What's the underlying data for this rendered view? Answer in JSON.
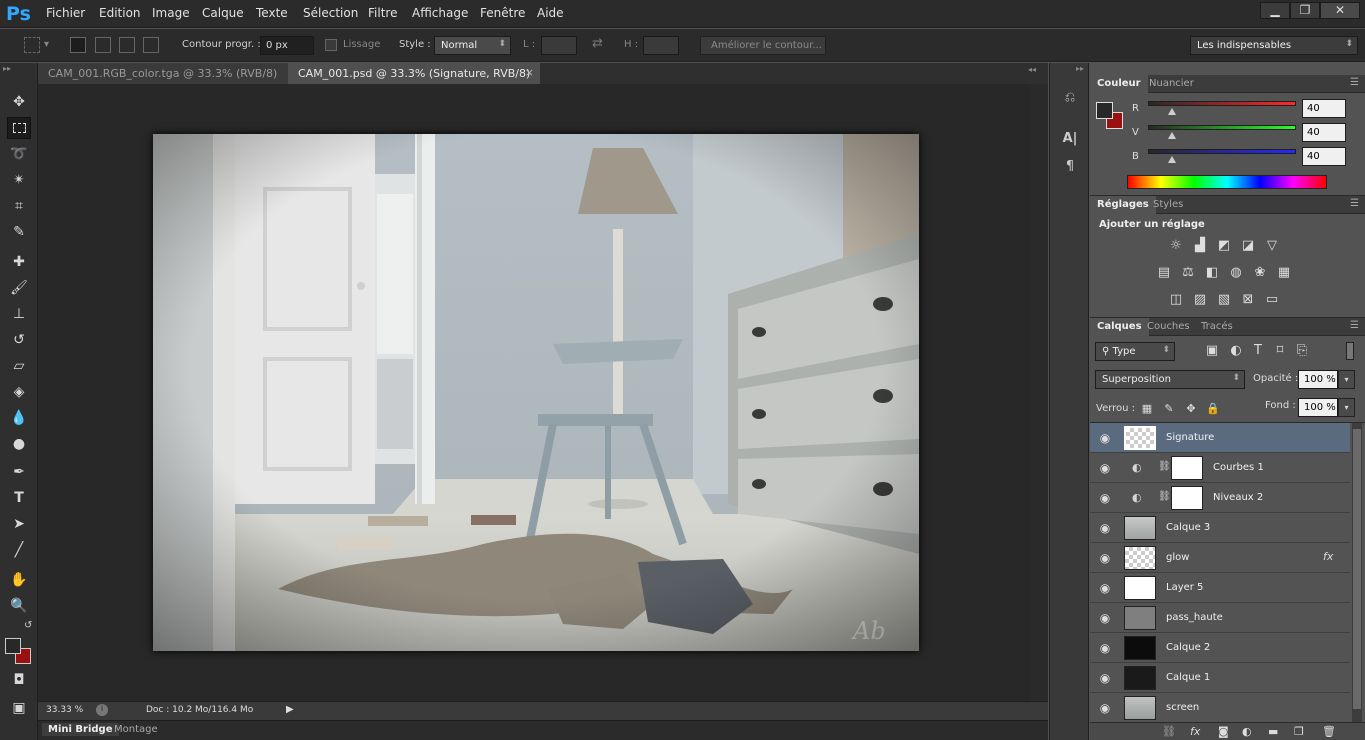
{
  "app": {
    "logo": "Ps"
  },
  "menu": [
    "Fichier",
    "Edition",
    "Image",
    "Calque",
    "Texte",
    "Sélection",
    "Filtre",
    "Affichage",
    "Fenêtre",
    "Aide"
  ],
  "window_buttons": {
    "minimize": "▁",
    "restore": "❐",
    "close": "✕"
  },
  "options": {
    "feather_label": "Contour progr. :",
    "feather_value": "0 px",
    "antialias_label": "Lissage",
    "style_label": "Style :",
    "style_value": "Normal",
    "width_label": "L :",
    "height_label": "H :",
    "refine_button": "Améliorer le contour...",
    "workspace": "Les indispensables"
  },
  "tabs": [
    {
      "label": "CAM_001.RGB_color.tga @ 33.3% (RVB/8)",
      "close": "×"
    },
    {
      "label": "CAM_001.psd @ 33.3% (Signature, RVB/8)",
      "close": "×"
    }
  ],
  "toolbar_icons": [
    "move-icon",
    "marquee-icon",
    "lasso-icon",
    "magic-wand-icon",
    "crop-icon",
    "eyedropper-icon",
    "healing-icon",
    "brush-icon",
    "stamp-icon",
    "history-brush-icon",
    "eraser-icon",
    "bucket-icon",
    "blur-icon",
    "dodge-icon",
    "pen-icon",
    "type-icon",
    "path-selection-icon",
    "line-icon",
    "hand-icon",
    "zoom-icon"
  ],
  "status": {
    "zoom": "33.33 %",
    "doc": "Doc : 10.2 Mo/116.4 Mo"
  },
  "bottom_tabs": [
    "Mini Bridge",
    "Montage"
  ],
  "color_panel": {
    "tabs": [
      "Couleur",
      "Nuancier"
    ],
    "channels": [
      {
        "label": "R",
        "value": "40"
      },
      {
        "label": "V",
        "value": "40"
      },
      {
        "label": "B",
        "value": "40"
      }
    ],
    "foreground": "#282828",
    "background": "#9b1111"
  },
  "adjustments_panel": {
    "tabs": [
      "Réglages",
      "Styles"
    ],
    "heading": "Ajouter un réglage"
  },
  "layers_panel": {
    "tabs": [
      "Calques",
      "Couches",
      "Tracés"
    ],
    "filter": "Type",
    "blend_mode": "Superposition",
    "opacity_label": "Opacité :",
    "opacity": "100 %",
    "lock_label": "Verrou :",
    "fill_label": "Fond :",
    "fill": "100 %",
    "layers": [
      {
        "name": "Signature",
        "selected": true
      },
      {
        "name": "Courbes 1"
      },
      {
        "name": "Niveaux 2"
      },
      {
        "name": "Calque 3"
      },
      {
        "name": "glow",
        "fx": "fx"
      },
      {
        "name": "Layer 5"
      },
      {
        "name": "pass_haute"
      },
      {
        "name": "Calque 2"
      },
      {
        "name": "Calque 1"
      },
      {
        "name": "screen"
      }
    ]
  },
  "colors": {
    "accent": "#31a8ff",
    "selected_layer": "#5a6b80"
  }
}
